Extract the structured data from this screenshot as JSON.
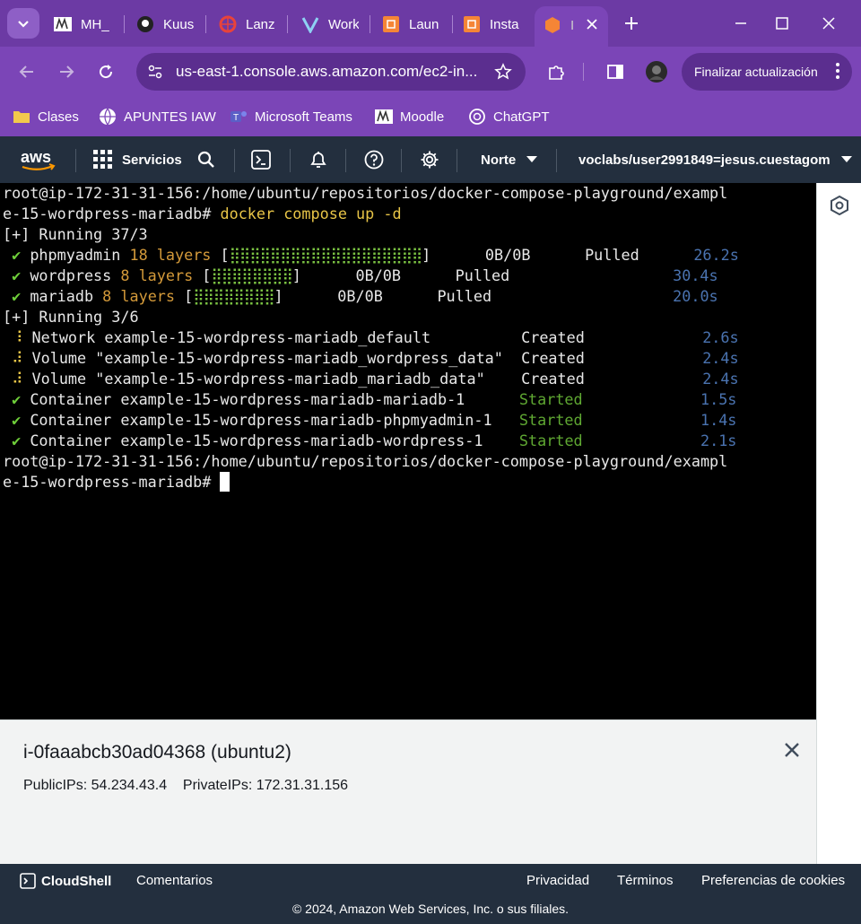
{
  "browser": {
    "tabs": [
      {
        "label": "MH_",
        "icon": "moodle-icon"
      },
      {
        "label": "Kuus",
        "icon": "github-icon"
      },
      {
        "label": "Lanz",
        "icon": "lanzadera-icon"
      },
      {
        "label": "Work",
        "icon": "vocareum-icon"
      },
      {
        "label": "Laun",
        "icon": "aws-cube-icon"
      },
      {
        "label": "Insta",
        "icon": "aws-cube-icon"
      },
      {
        "label": "I",
        "icon": "aws-orange-icon"
      }
    ],
    "url": "us-east-1.console.aws.amazon.com/ec2-in...",
    "update_button": "Finalizar actualización",
    "bookmarks": [
      {
        "label": "Clases",
        "icon": "folder-icon"
      },
      {
        "label": "APUNTES IAW",
        "icon": "globe-icon"
      },
      {
        "label": "Microsoft Teams",
        "icon": "teams-icon"
      },
      {
        "label": "Moodle",
        "icon": "moodle-icon"
      },
      {
        "label": "ChatGPT",
        "icon": "chatgpt-icon"
      }
    ]
  },
  "aws_nav": {
    "logo": "aws",
    "services": "Servicios",
    "region": "Norte",
    "account": "voclabs/user2991849=jesus.cuestagom"
  },
  "terminal": {
    "prompt1a": "root@ip-172-31-31-156:/home/ubuntu/repositorios/docker-compose-playground/exampl",
    "prompt1b": "e-15-wordpress-mariadb# ",
    "command": "docker compose up -d",
    "running1": "[+] Running 37/3",
    "pulls": [
      {
        "name": "phpmyadmin",
        "layers": "18 layers",
        "bar": "⣿⣿⣿⣿⣿⣿⣿⣿⣿⣿⣿⣿⣿⣿⣿⣿⣿⣿⣿",
        "size": "0B/0B",
        "status": "Pulled",
        "time": "26.2s"
      },
      {
        "name": "wordpress",
        "layers": "8 layers",
        "bar": "⣿⣿⣿⣿⣿⣿⣿⣿",
        "size": "0B/0B",
        "status": "Pulled",
        "time": "30.4s"
      },
      {
        "name": "mariadb",
        "layers": "8 layers",
        "bar": "⣿⣿⣿⣿⣿⣿⣿⣿",
        "size": "0B/0B",
        "status": "Pulled",
        "time": "20.0s"
      }
    ],
    "running2": "[+] Running 3/6",
    "resources": [
      {
        "mark": "⠸",
        "text": "Network example-15-wordpress-mariadb_default",
        "status": "Created",
        "time": "2.6s"
      },
      {
        "mark": "⠼",
        "text": "Volume \"example-15-wordpress-mariadb_wordpress_data\"",
        "status": "Created",
        "time": "2.4s"
      },
      {
        "mark": "⠼",
        "text": "Volume \"example-15-wordpress-mariadb_mariadb_data\"",
        "status": "Created",
        "time": "2.4s"
      },
      {
        "mark": "✔",
        "text": "Container example-15-wordpress-mariadb-mariadb-1",
        "status": "Started",
        "time": "1.5s"
      },
      {
        "mark": "✔",
        "text": "Container example-15-wordpress-mariadb-phpmyadmin-1",
        "status": "Started",
        "time": "1.4s"
      },
      {
        "mark": "✔",
        "text": "Container example-15-wordpress-mariadb-wordpress-1",
        "status": "Started",
        "time": "2.1s"
      }
    ],
    "prompt2a": "root@ip-172-31-31-156:/home/ubuntu/repositorios/docker-compose-playground/exampl",
    "prompt2b": "e-15-wordpress-mariadb# "
  },
  "instance": {
    "title": "i-0faaabcb30ad04368 (ubuntu2)",
    "public_ips_label": "PublicIPs:",
    "public_ips": "54.234.43.4",
    "private_ips_label": "PrivateIPs:",
    "private_ips": "172.31.31.156"
  },
  "footer": {
    "cloudshell": "CloudShell",
    "comentarios": "Comentarios",
    "privacidad": "Privacidad",
    "terminos": "Términos",
    "cookies": "Preferencias de cookies",
    "copyright": "© 2024, Amazon Web Services, Inc. o sus filiales."
  }
}
